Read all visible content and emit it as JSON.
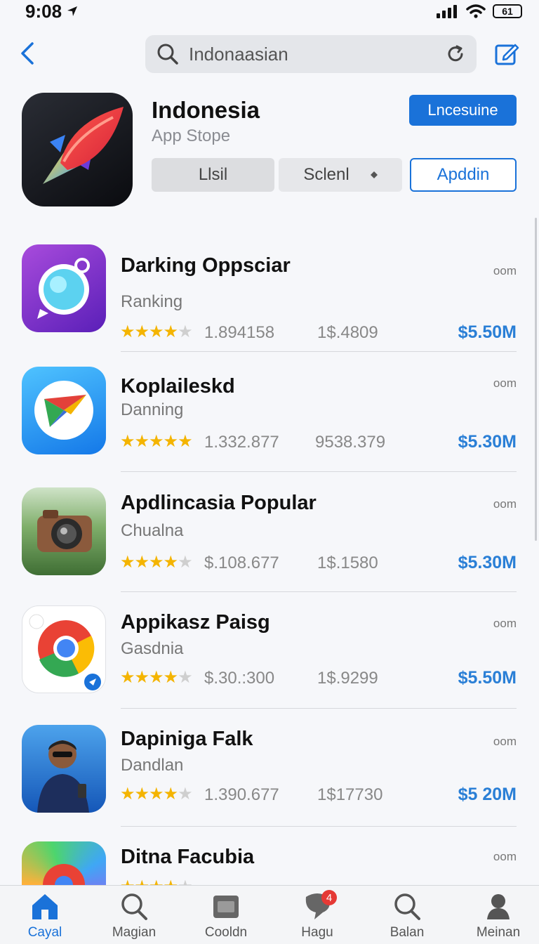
{
  "status": {
    "time": "9:08",
    "battery": "61"
  },
  "search": {
    "value": "Indonaasian"
  },
  "hero": {
    "title": "Indonesia",
    "subtitle": "App Stope",
    "primary_button": "Lncesuine",
    "segments": [
      "Llsil",
      "Sclenl",
      "Apddin"
    ]
  },
  "apps": [
    {
      "title": "Darking Oppsciar",
      "subtitle": "Ranking",
      "stars": 4,
      "count": "1.894158",
      "mid": "1$.4809",
      "price": "$5.50M",
      "tag": "oom"
    },
    {
      "title": "Koplaileskd",
      "subtitle": "Danning",
      "stars": 5,
      "count": "1.332.877",
      "mid": "9538.379",
      "price": "$5.30M",
      "tag": "oom"
    },
    {
      "title": "Apdlincasia Popular",
      "subtitle": "Chualna",
      "stars": 4,
      "count": "$.108.677",
      "mid": "1$.1580",
      "price": "$5.30M",
      "tag": "oom"
    },
    {
      "title": "Appikasz Paisg",
      "subtitle": "Gasdnia",
      "stars": 4,
      "count": "$.30.:300",
      "mid": "1$.9299",
      "price": "$5.50M",
      "tag": "oom"
    },
    {
      "title": "Dapiniga Falk",
      "subtitle": "Dandlan",
      "stars": 4,
      "count": "1.390.677",
      "mid": "1$17730",
      "price": "$5 20M",
      "tag": "oom"
    },
    {
      "title": "Ditna Facubia",
      "subtitle": "",
      "stars": 4,
      "count": "",
      "mid": "",
      "price": "",
      "tag": "oom"
    }
  ],
  "tabs": [
    {
      "label": "Cayal",
      "badge": ""
    },
    {
      "label": "Magian",
      "badge": ""
    },
    {
      "label": "Cooldn",
      "badge": ""
    },
    {
      "label": "Hagu",
      "badge": "4"
    },
    {
      "label": "Balan",
      "badge": ""
    },
    {
      "label": "Meinan",
      "badge": ""
    }
  ],
  "colors": {
    "accent": "#1a72d9",
    "price": "#2a7fd6",
    "star": "#f4b400"
  }
}
